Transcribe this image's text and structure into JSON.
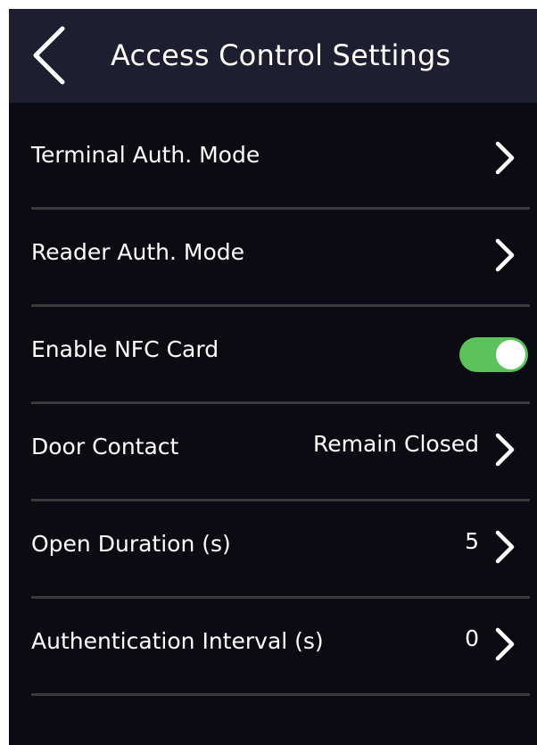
{
  "header": {
    "title": "Access Control Settings",
    "back_icon": "chevron-left-icon"
  },
  "settings": [
    {
      "label": "Terminal Auth. Mode",
      "value": "",
      "control": "chevron-right-icon"
    },
    {
      "label": "Reader Auth. Mode",
      "value": "",
      "control": "chevron-right-icon"
    },
    {
      "label": "Enable NFC Card",
      "value": "",
      "control": "toggle",
      "toggle_on": true
    },
    {
      "label": "Door Contact",
      "value": "Remain Closed",
      "control": "chevron-right-icon"
    },
    {
      "label": "Open Duration (s)",
      "value": "5",
      "control": "chevron-right-icon"
    },
    {
      "label": "Authentication Interval (s)",
      "value": "0",
      "control": "chevron-right-icon"
    }
  ],
  "colors": {
    "background": "#0b0b14",
    "header_background": "#1d1e2f",
    "toggle_on": "#5cc35c",
    "divider": "#3a3a3c",
    "text": "#ffffff"
  }
}
